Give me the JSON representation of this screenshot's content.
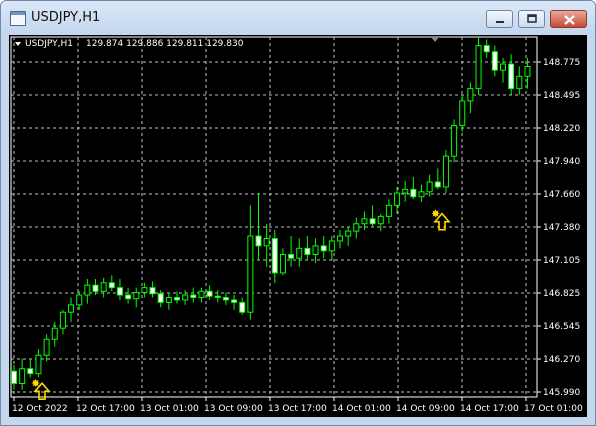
{
  "window": {
    "title": "USDJPY,H1",
    "icons": {
      "app": "chart-window-icon",
      "min": "minimize-icon",
      "max": "maximize-icon",
      "close": "close-icon"
    }
  },
  "chart_data": {
    "type": "candlestick",
    "symbol_label": "USDJPY,H1",
    "ohlc_label": "129.874 129.886 129.811 129.830",
    "y_ticks": [
      "148.775",
      "148.495",
      "148.220",
      "147.940",
      "147.660",
      "147.380",
      "147.105",
      "146.825",
      "146.545",
      "146.270",
      "145.990"
    ],
    "x_ticks": [
      "12 Oct 2022",
      "12 Oct 17:00",
      "13 Oct 01:00",
      "13 Oct 09:00",
      "13 Oct 17:00",
      "14 Oct 01:00",
      "14 Oct 09:00",
      "14 Oct 17:00",
      "17 Oct 01:00"
    ],
    "ylim": [
      145.99,
      148.92
    ],
    "grid": true,
    "colors": {
      "background": "#000000",
      "up_candle": "#000000",
      "down_candle": "#ffffff",
      "wick": "#00ff00",
      "grid": "#c0c0c0",
      "axis": "#ffffff",
      "arrow": "#ffd700"
    },
    "candles": [
      [
        146.2,
        146.25,
        146.05,
        146.1
      ],
      [
        146.1,
        146.3,
        146.05,
        146.22
      ],
      [
        146.22,
        146.3,
        146.15,
        146.18
      ],
      [
        146.18,
        146.38,
        146.15,
        146.33
      ],
      [
        146.33,
        146.5,
        146.28,
        146.46
      ],
      [
        146.46,
        146.6,
        146.4,
        146.55
      ],
      [
        146.55,
        146.7,
        146.5,
        146.68
      ],
      [
        146.68,
        146.8,
        146.6,
        146.74
      ],
      [
        146.74,
        146.85,
        146.7,
        146.82
      ],
      [
        146.82,
        146.95,
        146.75,
        146.9
      ],
      [
        146.9,
        146.95,
        146.82,
        146.85
      ],
      [
        146.85,
        146.96,
        146.8,
        146.92
      ],
      [
        146.92,
        146.98,
        146.85,
        146.88
      ],
      [
        146.88,
        146.95,
        146.78,
        146.82
      ],
      [
        146.82,
        146.88,
        146.75,
        146.79
      ],
      [
        146.79,
        146.88,
        146.72,
        146.84
      ],
      [
        146.84,
        146.92,
        146.8,
        146.88
      ],
      [
        146.88,
        146.93,
        146.8,
        146.83
      ],
      [
        146.83,
        146.86,
        146.72,
        146.76
      ],
      [
        146.76,
        146.84,
        146.7,
        146.8
      ],
      [
        146.8,
        146.85,
        146.75,
        146.78
      ],
      [
        146.78,
        146.86,
        146.74,
        146.82
      ],
      [
        146.82,
        146.88,
        146.76,
        146.8
      ],
      [
        146.8,
        146.88,
        146.76,
        146.85
      ],
      [
        146.85,
        146.9,
        146.78,
        146.81
      ],
      [
        146.81,
        146.86,
        146.76,
        146.8
      ],
      [
        146.8,
        146.84,
        146.74,
        146.78
      ],
      [
        146.78,
        146.82,
        146.7,
        146.76
      ],
      [
        146.76,
        146.8,
        146.66,
        146.68
      ],
      [
        146.68,
        147.55,
        146.62,
        147.3
      ],
      [
        147.3,
        147.65,
        147.1,
        147.22
      ],
      [
        147.22,
        147.4,
        147.05,
        147.28
      ],
      [
        147.28,
        147.35,
        146.92,
        147.0
      ],
      [
        147.0,
        147.2,
        146.98,
        147.15
      ],
      [
        147.15,
        147.3,
        147.05,
        147.12
      ],
      [
        147.12,
        147.28,
        147.05,
        147.2
      ],
      [
        147.2,
        147.3,
        147.1,
        147.15
      ],
      [
        147.15,
        147.28,
        147.08,
        147.22
      ],
      [
        147.22,
        147.3,
        147.12,
        147.18
      ],
      [
        147.18,
        147.3,
        147.1,
        147.26
      ],
      [
        147.26,
        147.35,
        147.2,
        147.3
      ],
      [
        147.3,
        147.38,
        147.22,
        147.34
      ],
      [
        147.34,
        147.45,
        147.28,
        147.4
      ],
      [
        147.4,
        147.5,
        147.35,
        147.44
      ],
      [
        147.44,
        147.55,
        147.38,
        147.4
      ],
      [
        147.4,
        147.48,
        147.34,
        147.46
      ],
      [
        147.46,
        147.6,
        147.4,
        147.55
      ],
      [
        147.55,
        147.7,
        147.48,
        147.65
      ],
      [
        147.65,
        147.75,
        147.58,
        147.68
      ],
      [
        147.68,
        147.78,
        147.6,
        147.62
      ],
      [
        147.62,
        147.72,
        147.58,
        147.66
      ],
      [
        147.66,
        147.8,
        147.62,
        147.74
      ],
      [
        147.74,
        147.85,
        147.68,
        147.7
      ],
      [
        147.7,
        148.0,
        147.65,
        147.95
      ],
      [
        147.95,
        148.25,
        147.9,
        148.2
      ],
      [
        148.2,
        148.45,
        148.15,
        148.4
      ],
      [
        148.4,
        148.55,
        148.3,
        148.5
      ],
      [
        148.5,
        148.92,
        148.45,
        148.85
      ],
      [
        148.85,
        148.9,
        148.75,
        148.8
      ],
      [
        148.8,
        148.85,
        148.6,
        148.65
      ],
      [
        148.65,
        148.75,
        148.55,
        148.7
      ],
      [
        148.7,
        148.78,
        148.45,
        148.5
      ],
      [
        148.5,
        148.68,
        148.45,
        148.6
      ],
      [
        148.6,
        148.75,
        148.5,
        148.68
      ]
    ],
    "arrows": [
      {
        "x": "12 Oct 2022",
        "price": 146.2
      },
      {
        "x": "14 Oct 09:00",
        "price": 147.58
      }
    ]
  }
}
